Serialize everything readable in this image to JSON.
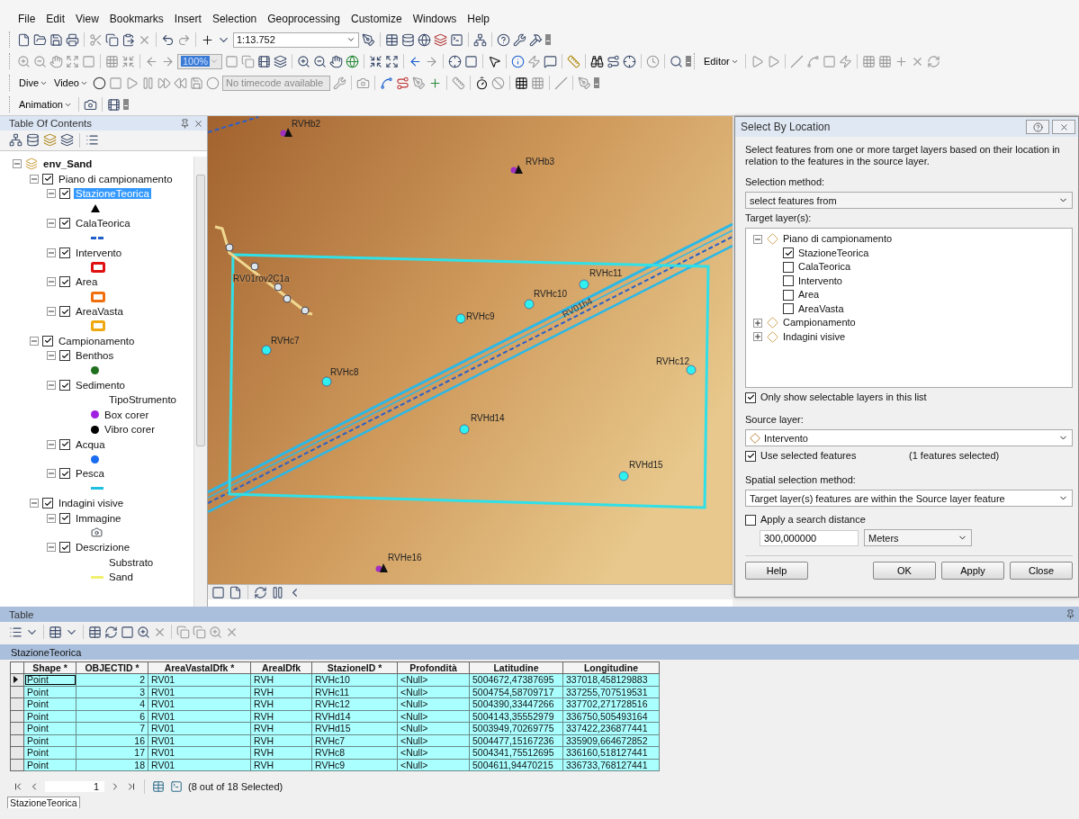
{
  "menu": [
    "File",
    "Edit",
    "View",
    "Bookmarks",
    "Insert",
    "Selection",
    "Geoprocessing",
    "Customize",
    "Windows",
    "Help"
  ],
  "toolbars": {
    "scale": "1:13.752",
    "zoom": "100%",
    "editor": "Editor",
    "dive": "Dive",
    "video": "Video",
    "timecode": "No timecode available",
    "animation": "Animation"
  },
  "toc": {
    "title": "Table Of Contents",
    "tree": [
      {
        "kind": "frame",
        "label": "env_Sand",
        "expanded": true,
        "children": [
          {
            "kind": "group",
            "label": "Piano di campionamento",
            "checked": true,
            "expanded": true,
            "children": [
              {
                "kind": "layer",
                "label": "StazioneTeorica",
                "checked": true,
                "expanded": true,
                "selected": true,
                "children": [
                  {
                    "kind": "triangle",
                    "color": "#000000"
                  }
                ]
              },
              {
                "kind": "layer",
                "label": "CalaTeorica",
                "checked": true,
                "expanded": true,
                "selected": false,
                "children": [
                  {
                    "kind": "dash",
                    "color": "#2060c8"
                  }
                ]
              },
              {
                "kind": "layer",
                "label": "Intervento",
                "checked": true,
                "expanded": true,
                "selected": false,
                "children": [
                  {
                    "kind": "polygon",
                    "color": "#e01010"
                  }
                ]
              },
              {
                "kind": "layer",
                "label": "Area",
                "checked": true,
                "expanded": true,
                "selected": false,
                "children": [
                  {
                    "kind": "polygon",
                    "color": "#f07010"
                  }
                ]
              },
              {
                "kind": "layer",
                "label": "AreaVasta",
                "checked": true,
                "expanded": true,
                "selected": false,
                "children": [
                  {
                    "kind": "polygon",
                    "color": "#f0a810"
                  }
                ]
              }
            ]
          },
          {
            "kind": "group",
            "label": "Campionamento",
            "checked": true,
            "expanded": true,
            "children": [
              {
                "kind": "layer",
                "label": "Benthos",
                "checked": true,
                "expanded": true,
                "selected": false,
                "children": [
                  {
                    "kind": "dot",
                    "color": "#207020"
                  }
                ]
              },
              {
                "kind": "layer",
                "label": "Sedimento",
                "checked": true,
                "expanded": true,
                "selected": false,
                "children": [
                  {
                    "kind": "heading",
                    "label": "TipoStrumento"
                  },
                  {
                    "kind": "dot",
                    "label": "Box corer",
                    "color": "#a020e0"
                  },
                  {
                    "kind": "dot",
                    "label": "Vibro corer",
                    "color": "#000000"
                  }
                ]
              },
              {
                "kind": "layer",
                "label": "Acqua",
                "checked": true,
                "expanded": true,
                "selected": false,
                "children": [
                  {
                    "kind": "dot",
                    "color": "#1a6cf0"
                  }
                ]
              },
              {
                "kind": "layer",
                "label": "Pesca",
                "checked": true,
                "expanded": true,
                "selected": false,
                "children": [
                  {
                    "kind": "line",
                    "color": "#20c0e0"
                  }
                ]
              }
            ]
          },
          {
            "kind": "group",
            "label": "Indagini visive",
            "checked": true,
            "expanded": true,
            "children": [
              {
                "kind": "layer",
                "label": "Immagine",
                "checked": true,
                "expanded": true,
                "selected": false,
                "children": [
                  {
                    "kind": "camera"
                  }
                ]
              },
              {
                "kind": "layer",
                "label": "Descrizione",
                "checked": true,
                "expanded": true,
                "selected": false,
                "children": [
                  {
                    "kind": "heading",
                    "label": "Substrato"
                  },
                  {
                    "kind": "line",
                    "label": "Sand",
                    "color": "#f0f070"
                  }
                ]
              }
            ]
          }
        ]
      }
    ]
  },
  "map": {
    "stations": [
      {
        "label": "RVHb2",
        "selected": false
      },
      {
        "label": "RVHb3",
        "selected": false
      },
      {
        "label": "RVHc11",
        "selected": true
      },
      {
        "label": "RVHc10",
        "selected": true
      },
      {
        "label": "RVHc9",
        "selected": true
      },
      {
        "label": "RVHc7",
        "selected": true
      },
      {
        "label": "RVHc8",
        "selected": true
      },
      {
        "label": "RVHc12",
        "selected": true
      },
      {
        "label": "RVHd14",
        "selected": true
      },
      {
        "label": "RVHd15",
        "selected": true
      },
      {
        "label": "RVHe16",
        "selected": false
      }
    ],
    "track": "RV01rov2C1a",
    "line": "RV01h4"
  },
  "dialog": {
    "title": "Select By Location",
    "description": "Select features from one or more target layers based on their location in relation to the features in the source layer.",
    "selection_method_label": "Selection method:",
    "selection_method": "select features from",
    "target_label": "Target layer(s):",
    "targets": [
      {
        "label": "Piano di campionamento",
        "expanded": true,
        "children": [
          {
            "label": "StazioneTeorica",
            "checked": true
          },
          {
            "label": "CalaTeorica",
            "checked": false
          },
          {
            "label": "Intervento",
            "checked": false
          },
          {
            "label": "Area",
            "checked": false
          },
          {
            "label": "AreaVasta",
            "checked": false
          }
        ]
      },
      {
        "label": "Campionamento",
        "expanded": false
      },
      {
        "label": "Indagini visive",
        "expanded": false
      }
    ],
    "only_selectable": {
      "label": "Only show selectable layers in this list",
      "checked": true
    },
    "source_label": "Source layer:",
    "source": "Intervento",
    "use_selected": {
      "label": "Use selected features",
      "checked": true
    },
    "selected_count": "(1 features selected)",
    "spatial_label": "Spatial selection method:",
    "spatial_method": "Target layer(s) features are within the Source layer feature",
    "search_distance": {
      "label": "Apply a search distance",
      "checked": false
    },
    "distance": "300,000000",
    "units": "Meters",
    "buttons": [
      "Help",
      "OK",
      "Apply",
      "Close"
    ]
  },
  "table": {
    "title": "Table",
    "tab": "StazioneTeorica",
    "columns": [
      "Shape *",
      "OBJECTID *",
      "AreaVastaIDfk *",
      "AreaIDfk",
      "StazioneID *",
      "Profondità",
      "Latitudine",
      "Longitudine"
    ],
    "rows": [
      {
        "current": true,
        "selected": true,
        "cells": [
          "Point",
          "2",
          "RV01",
          "RVH",
          "RVHc10",
          "<Null>",
          "5004672,47387695",
          "337018,458129883"
        ]
      },
      {
        "current": false,
        "selected": true,
        "cells": [
          "Point",
          "3",
          "RV01",
          "RVH",
          "RVHc11",
          "<Null>",
          "5004754,58709717",
          "337255,707519531"
        ]
      },
      {
        "current": false,
        "selected": true,
        "cells": [
          "Point",
          "4",
          "RV01",
          "RVH",
          "RVHc12",
          "<Null>",
          "5004390,33447266",
          "337702,271728516"
        ]
      },
      {
        "current": false,
        "selected": true,
        "cells": [
          "Point",
          "6",
          "RV01",
          "RVH",
          "RVHd14",
          "<Null>",
          "5004143,35552979",
          "336750,505493164"
        ]
      },
      {
        "current": false,
        "selected": true,
        "cells": [
          "Point",
          "7",
          "RV01",
          "RVH",
          "RVHd15",
          "<Null>",
          "5003949,70269775",
          "337422,236877441"
        ]
      },
      {
        "current": false,
        "selected": true,
        "cells": [
          "Point",
          "16",
          "RV01",
          "RVH",
          "RVHc7",
          "<Null>",
          "5004477,15167236",
          "335909,664672852"
        ]
      },
      {
        "current": false,
        "selected": true,
        "cells": [
          "Point",
          "17",
          "RV01",
          "RVH",
          "RVHc8",
          "<Null>",
          "5004341,75512695",
          "336160,518127441"
        ]
      },
      {
        "current": false,
        "selected": true,
        "cells": [
          "Point",
          "18",
          "RV01",
          "RVH",
          "RVHc9",
          "<Null>",
          "5004611,94470215",
          "336733,768127441"
        ]
      }
    ],
    "page": "1",
    "status": "(8 out of 18 Selected)",
    "bottom_tab": "StazioneTeorica"
  }
}
